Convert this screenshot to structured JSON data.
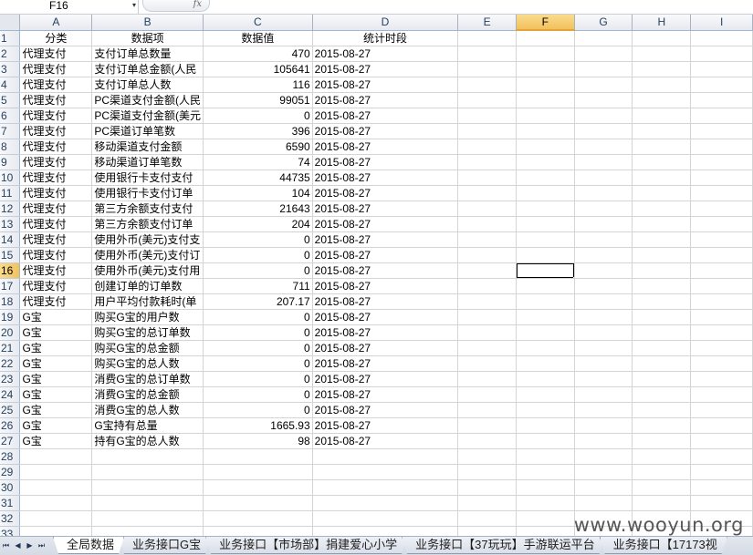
{
  "formula_bar": {
    "name_box_value": "F16",
    "dropdown_glyph": "▾",
    "fx_label": "fx",
    "formula_value": ""
  },
  "columns": [
    "A",
    "B",
    "C",
    "D",
    "E",
    "F",
    "G",
    "H",
    "I"
  ],
  "selected_column": "F",
  "selected_row": 16,
  "rows": [
    [
      "分类",
      "数据项",
      "数据值",
      "统计时段"
    ],
    [
      "代理支付",
      "支付订单总数量",
      "470",
      "2015-08-27"
    ],
    [
      "代理支付",
      "支付订单总金额(人民",
      "105641",
      "2015-08-27"
    ],
    [
      "代理支付",
      "支付订单总人数",
      "116",
      "2015-08-27"
    ],
    [
      "代理支付",
      "PC渠道支付金额(人民",
      "99051",
      "2015-08-27"
    ],
    [
      "代理支付",
      "PC渠道支付金额(美元",
      "0",
      "2015-08-27"
    ],
    [
      "代理支付",
      "PC渠道订单笔数",
      "396",
      "2015-08-27"
    ],
    [
      "代理支付",
      "移动渠道支付金额",
      "6590",
      "2015-08-27"
    ],
    [
      "代理支付",
      "移动渠道订单笔数",
      "74",
      "2015-08-27"
    ],
    [
      "代理支付",
      "使用银行卡支付支付",
      "44735",
      "2015-08-27"
    ],
    [
      "代理支付",
      "使用银行卡支付订单",
      "104",
      "2015-08-27"
    ],
    [
      "代理支付",
      "第三方余额支付支付",
      "21643",
      "2015-08-27"
    ],
    [
      "代理支付",
      "第三方余额支付订单",
      "204",
      "2015-08-27"
    ],
    [
      "代理支付",
      "使用外币(美元)支付支",
      "0",
      "2015-08-27"
    ],
    [
      "代理支付",
      "使用外币(美元)支付订",
      "0",
      "2015-08-27"
    ],
    [
      "代理支付",
      "使用外币(美元)支付用",
      "0",
      "2015-08-27"
    ],
    [
      "代理支付",
      "创建订单的订单数",
      "711",
      "2015-08-27"
    ],
    [
      "代理支付",
      "用户平均付款耗时(单",
      "207.17",
      "2015-08-27"
    ],
    [
      "G宝",
      "购买G宝的用户数",
      "0",
      "2015-08-27"
    ],
    [
      "G宝",
      "购买G宝的总订单数",
      "0",
      "2015-08-27"
    ],
    [
      "G宝",
      "购买G宝的总金额",
      "0",
      "2015-08-27"
    ],
    [
      "G宝",
      "购买G宝的总人数",
      "0",
      "2015-08-27"
    ],
    [
      "G宝",
      "消费G宝的总订单数",
      "0",
      "2015-08-27"
    ],
    [
      "G宝",
      "消费G宝的总金额",
      "0",
      "2015-08-27"
    ],
    [
      "G宝",
      "消费G宝的总人数",
      "0",
      "2015-08-27"
    ],
    [
      "G宝",
      "G宝持有总量",
      "1665.93",
      "2015-08-27"
    ],
    [
      "G宝",
      "持有G宝的总人数",
      "98",
      "2015-08-27"
    ],
    [
      "",
      "",
      "",
      ""
    ],
    [
      "",
      "",
      "",
      ""
    ],
    [
      "",
      "",
      "",
      ""
    ],
    [
      "",
      "",
      "",
      ""
    ],
    [
      "",
      "",
      "",
      ""
    ],
    [
      "",
      "",
      "",
      ""
    ]
  ],
  "sheet_nav": [
    "⏮",
    "◀",
    "▶",
    "⏭"
  ],
  "sheet_tabs": [
    {
      "label": "全局数据",
      "active": true
    },
    {
      "label": "业务接口G宝",
      "active": false
    },
    {
      "label": "业务接口【市场部】捐建爱心小学",
      "active": false
    },
    {
      "label": "业务接口【37玩玩】手游联运平台",
      "active": false
    },
    {
      "label": "业务接口【17173视",
      "active": false
    }
  ],
  "watermark": "www.wooyun.org"
}
